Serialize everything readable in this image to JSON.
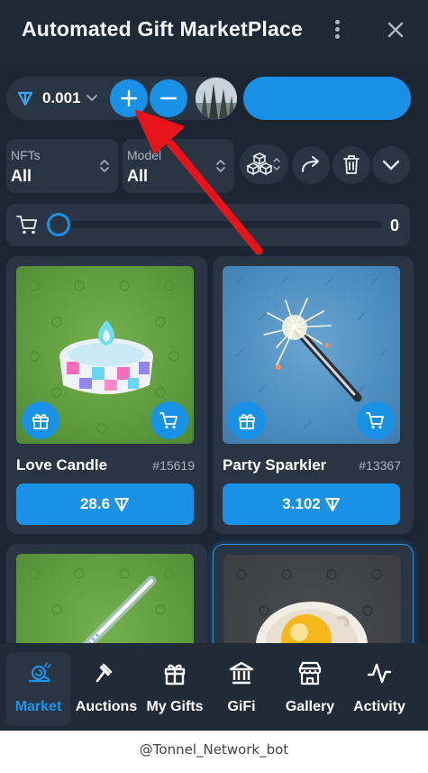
{
  "header": {
    "title": "Automated Gift MarketPlace",
    "menu_icon": "kebab-menu-icon",
    "close_icon": "close-icon"
  },
  "topbar": {
    "balance": "0.001",
    "currency_icon": "ton-icon",
    "add_icon": "plus-icon",
    "remove_icon": "minus-icon"
  },
  "filters": {
    "nfts": {
      "label": "NFTs",
      "value": "All"
    },
    "model": {
      "label": "Model",
      "value": "All"
    }
  },
  "cart_slider": {
    "value": "0",
    "fill_fraction": 0
  },
  "cards": [
    {
      "name": "Love Candle",
      "number": "#15619",
      "price": "28.6"
    },
    {
      "name": "Party Sparkler",
      "number": "#13367",
      "price": "3.102"
    },
    {
      "name": "",
      "number": "",
      "price": ""
    },
    {
      "name": "",
      "number": "",
      "price": ""
    }
  ],
  "nav": {
    "items": [
      {
        "label": "Market",
        "icon": "snail-icon",
        "active": true
      },
      {
        "label": "Auctions",
        "icon": "gavel-icon",
        "active": false
      },
      {
        "label": "My Gifts",
        "icon": "gift-icon",
        "active": false
      },
      {
        "label": "GiFi",
        "icon": "bank-icon",
        "active": false
      },
      {
        "label": "Gallery",
        "icon": "store-icon",
        "active": false
      },
      {
        "label": "Activity",
        "icon": "activity-icon",
        "active": false
      }
    ]
  },
  "footer": {
    "bot_handle": "@Tonnel_Network_bot"
  },
  "colors": {
    "background": "#1c2633",
    "panel": "#2a3544",
    "accent": "#1991e6",
    "annotation_arrow": "#e8141b"
  }
}
